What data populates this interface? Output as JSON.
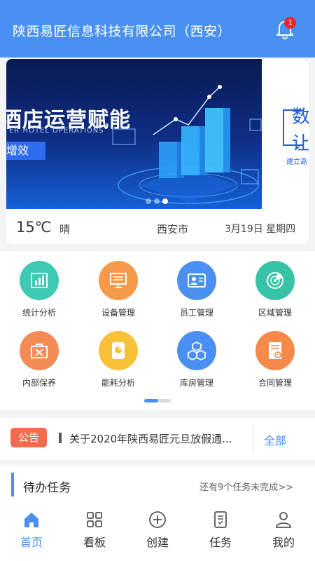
{
  "header": {
    "title": "陕西易匠信息科技有限公司（西安）",
    "notification_count": "1"
  },
  "banner": {
    "title": "酒店运营赋能",
    "subtitle": "ER HOTEL OPERATIONS",
    "tag": "增效",
    "side_line1": "数",
    "side_line2": "让",
    "side_line3": "建立高",
    "slide_count": 3,
    "active_slide": 3
  },
  "weather": {
    "temperature": "15℃",
    "condition": "晴",
    "city": "西安市",
    "date": "3月19日 星期四"
  },
  "grid": {
    "items": [
      {
        "label": "统计分析",
        "icon": "bar-chart-icon",
        "color": "#3ec9b2"
      },
      {
        "label": "设备管理",
        "icon": "monitor-icon",
        "color": "#f69a4a"
      },
      {
        "label": "员工管理",
        "icon": "id-card-icon",
        "color": "#4a8ff2"
      },
      {
        "label": "区域管理",
        "icon": "radar-icon",
        "color": "#37c3a6"
      },
      {
        "label": "内部保养",
        "icon": "toolbox-icon",
        "color": "#f48a55"
      },
      {
        "label": "能耗分析",
        "icon": "energy-icon",
        "color": "#f7c23a"
      },
      {
        "label": "库房管理",
        "icon": "boxes-icon",
        "color": "#4a8ff2"
      },
      {
        "label": "合同管理",
        "icon": "contract-icon",
        "color": "#f68a4a"
      }
    ]
  },
  "notice": {
    "tag": "公告",
    "text": "关于2020年陕西易匠元旦放假通...",
    "all_label": "全部"
  },
  "todo": {
    "title": "待办任务",
    "more": "还有9个任务未完成>>"
  },
  "tabbar": {
    "items": [
      {
        "label": "首页",
        "icon": "home-icon",
        "active": true
      },
      {
        "label": "看板",
        "icon": "dashboard-icon",
        "active": false
      },
      {
        "label": "创建",
        "icon": "plus-circle-icon",
        "active": false
      },
      {
        "label": "任务",
        "icon": "task-icon",
        "active": false
      },
      {
        "label": "我的",
        "icon": "user-icon",
        "active": false
      }
    ]
  },
  "colors": {
    "primary": "#4a90f0",
    "notice_tag": "#f26b4c",
    "badge": "#e8262d"
  }
}
